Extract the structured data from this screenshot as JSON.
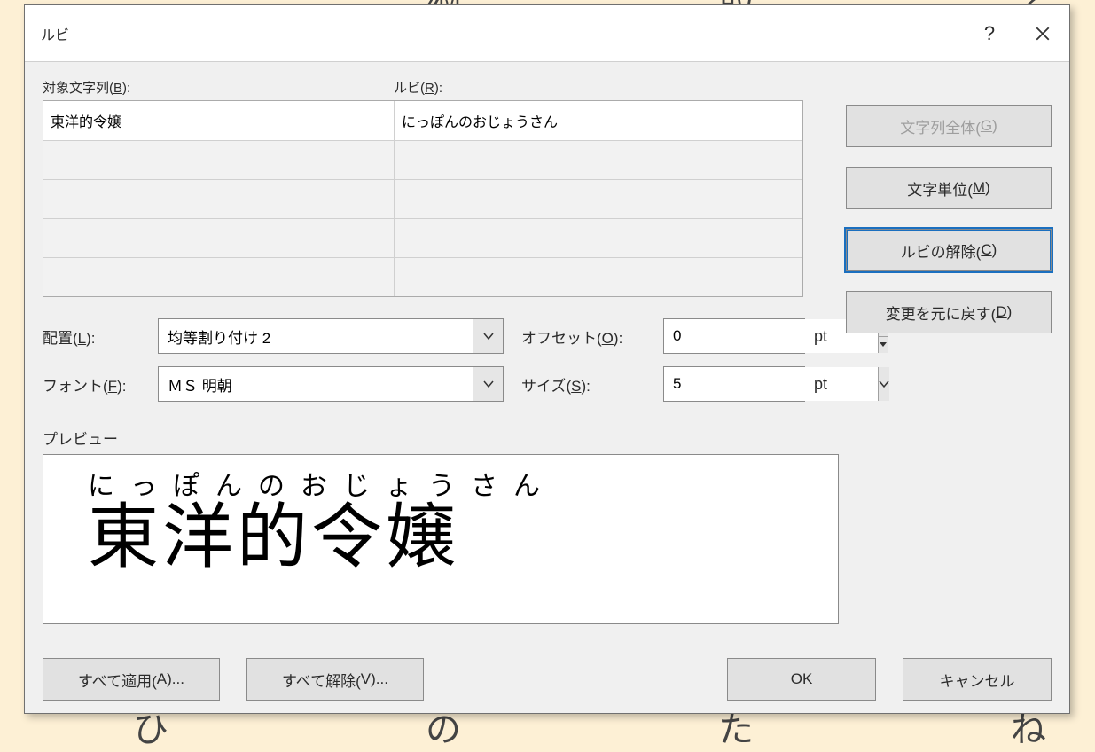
{
  "background_lines": [
    "え　　綱　　取　　る　　ン　　ぎ　　ゑ",
    "ひ　　の　　た　　ね　　て　　の"
  ],
  "dialog": {
    "title": "ルビ",
    "labels": {
      "target": "対象文字列(",
      "target_key": "B",
      "target_suffix": "):",
      "ruby": "ルビ(",
      "ruby_key": "R",
      "ruby_suffix": "):",
      "align": "配置(",
      "align_key": "L",
      "align_suffix": "):",
      "offset": "オフセット(",
      "offset_key": "O",
      "offset_suffix": "):",
      "font": "フォント(",
      "font_key": "F",
      "font_suffix": "):",
      "size": "サイズ(",
      "size_key": "S",
      "size_suffix": "):",
      "pt": "pt",
      "preview": "プレビュー"
    },
    "grid": {
      "rows": [
        {
          "target": "東洋的令嬢",
          "ruby": "にっぽんのおじょうさん",
          "enabled": true
        },
        {
          "target": "",
          "ruby": "",
          "enabled": false
        },
        {
          "target": "",
          "ruby": "",
          "enabled": false
        },
        {
          "target": "",
          "ruby": "",
          "enabled": false
        },
        {
          "target": "",
          "ruby": "",
          "enabled": false
        }
      ]
    },
    "side_buttons": {
      "group": {
        "label": "文字列全体(",
        "key": "G",
        "suffix": ")",
        "enabled": false
      },
      "mono": {
        "label": "文字単位(",
        "key": "M",
        "suffix": ")",
        "enabled": true
      },
      "clear": {
        "label": "ルビの解除(",
        "key": "C",
        "suffix": ")",
        "enabled": true,
        "focused": true
      },
      "undo": {
        "label": "変更を元に戻す(",
        "key": "D",
        "suffix": ")",
        "enabled": true
      }
    },
    "align_value": "均等割り付け 2",
    "offset_value": "0",
    "font_value": "ＭＳ 明朝",
    "size_value": "5",
    "preview": {
      "ruby": "にっぽんのおじょうさん",
      "base": "東洋的令嬢"
    },
    "bottom": {
      "apply_all": {
        "label": "すべて適用(",
        "key": "A",
        "suffix": ")..."
      },
      "remove_all": {
        "label": "すべて解除(",
        "key": "V",
        "suffix": ")..."
      },
      "ok": "OK",
      "cancel": "キャンセル"
    }
  }
}
